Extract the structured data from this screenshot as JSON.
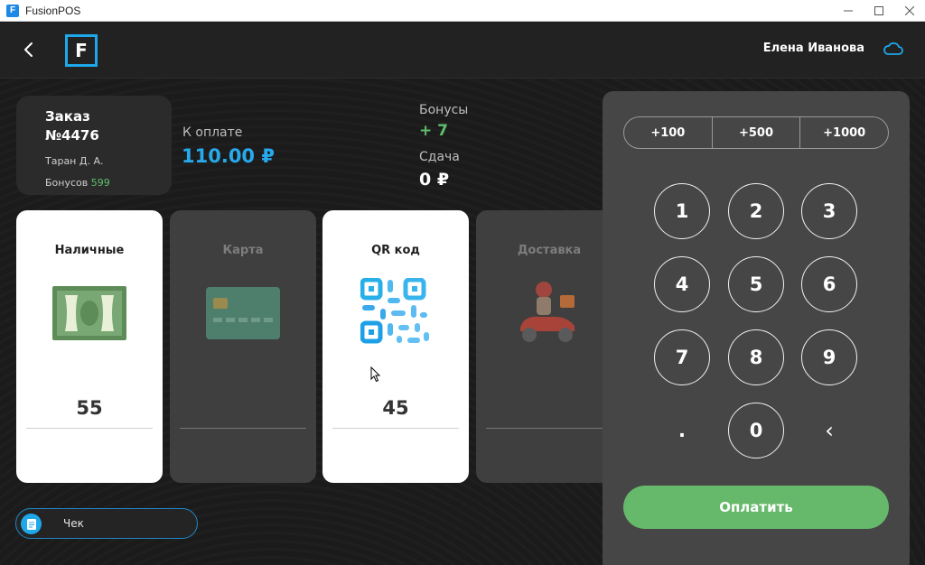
{
  "window": {
    "title": "FusionPOS",
    "app_icon_letter": "F"
  },
  "header": {
    "logo_letter": "F",
    "user_name": "Елена Иванова"
  },
  "order": {
    "title": "Заказ",
    "number": "№4476",
    "client": "Таран Д. А.",
    "bonus_label": "Бонусов",
    "bonus_value": "599"
  },
  "summary": {
    "to_pay_label": "К оплате",
    "to_pay_amount": "110.00 ₽",
    "bonus_label": "Бонусы",
    "bonus_value": "+ 7",
    "change_label": "Сдача",
    "change_value": "0 ₽"
  },
  "methods": [
    {
      "label": "Наличные",
      "value": "55",
      "active": true,
      "icon": "cash-icon"
    },
    {
      "label": "Карта",
      "value": "",
      "active": false,
      "icon": "card-icon"
    },
    {
      "label": "QR код",
      "value": "45",
      "active": true,
      "icon": "qr-code-icon"
    },
    {
      "label": "Доставка",
      "value": "",
      "active": false,
      "icon": "delivery-scooter-icon"
    }
  ],
  "receipt": {
    "label": "Чек"
  },
  "keypad": {
    "quick": [
      "+100",
      "+500",
      "+1000"
    ],
    "keys": [
      "1",
      "2",
      "3",
      "4",
      "5",
      "6",
      "7",
      "8",
      "9",
      ".",
      "0"
    ],
    "backspace_symbol": "‹",
    "pay_label": "Оплатить"
  },
  "colors": {
    "accent_blue": "#27a9ec",
    "green": "#5fbf6b",
    "pay_button": "#66b96a",
    "panel": "#464646"
  }
}
